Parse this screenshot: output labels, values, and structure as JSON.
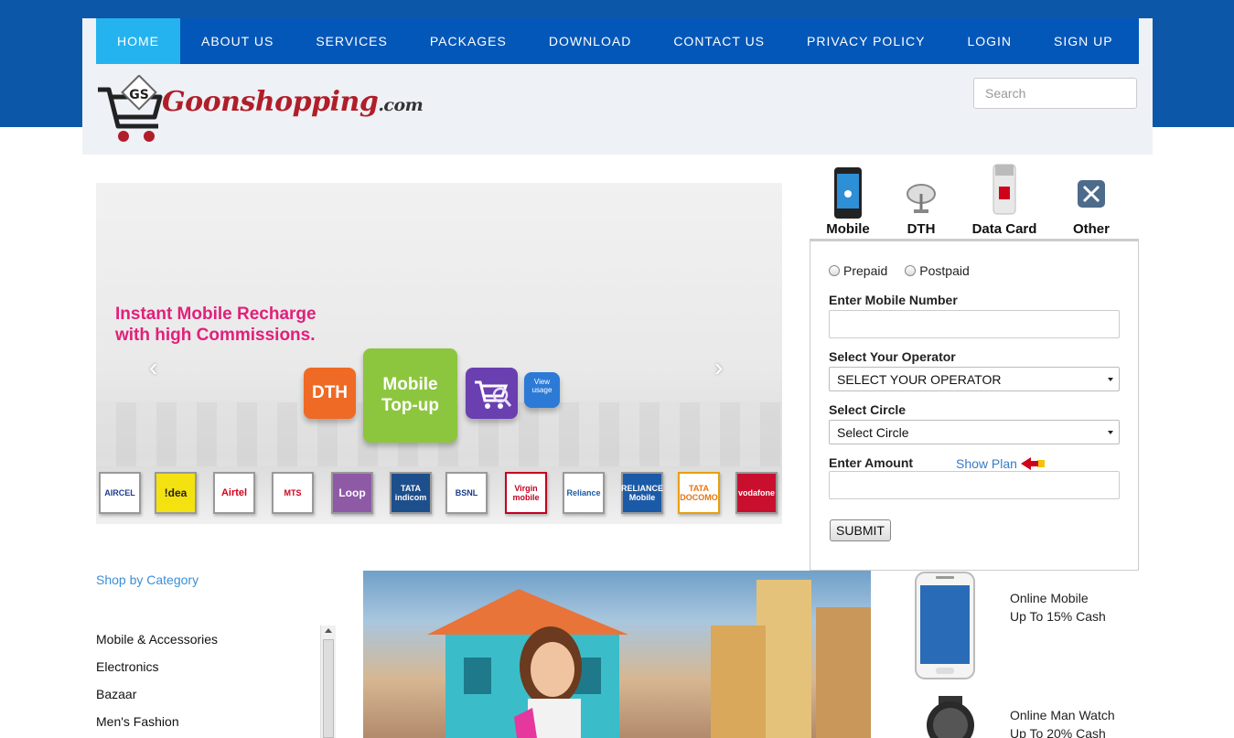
{
  "nav": {
    "items": [
      {
        "label": "HOME",
        "active": true
      },
      {
        "label": "ABOUT US"
      },
      {
        "label": "SERVICES"
      },
      {
        "label": "PACKAGES"
      },
      {
        "label": "DOWNLOAD"
      },
      {
        "label": "CONTACT US"
      },
      {
        "label": "PRIVACY POLICY"
      },
      {
        "label": "LOGIN"
      },
      {
        "label": "SIGN UP"
      }
    ]
  },
  "brand": {
    "initials": "GS",
    "name": "Goonshopping",
    "suffix": ".com"
  },
  "search": {
    "placeholder": "Search"
  },
  "banner": {
    "headline_line1": "Instant Mobile Recharge",
    "headline_line2": "with high Commissions.",
    "tile_dth": "DTH",
    "tile_mobile_line1": "Mobile",
    "tile_mobile_line2": "Top-up",
    "tile_usage": "View usage",
    "operators": [
      "AIRCEL",
      "!dea",
      "Airtel",
      "MTS",
      "Loop",
      "TATA indicom",
      "BSNL",
      "Virgin mobile",
      "Reliance",
      "RELIANCE Mobile",
      "TATA DOCOMO",
      "vodafone"
    ]
  },
  "services": {
    "tabs": [
      {
        "label": "Mobile",
        "icon": "mobile-phone-icon"
      },
      {
        "label": "DTH",
        "icon": "satellite-dish-icon"
      },
      {
        "label": "Data Card",
        "icon": "data-card-icon"
      },
      {
        "label": "Other",
        "icon": "tools-icon"
      }
    ]
  },
  "recharge_form": {
    "prepaid": "Prepaid",
    "postpaid": "Postpaid",
    "mobile_label": "Enter Mobile Number",
    "mobile_value": "",
    "operator_label": "Select Your Operator",
    "operator_value": "SELECT YOUR OPERATOR",
    "circle_label": "Select Circle",
    "circle_value": "Select Circle",
    "amount_label": "Enter Amount",
    "amount_value": "",
    "show_plan": "Show Plan",
    "submit": "SUBMIT"
  },
  "categories": {
    "heading": "Shop by Category",
    "items": [
      "Mobile & Accessories",
      "Electronics",
      "Bazaar",
      "Men's Fashion"
    ]
  },
  "products": [
    {
      "line1": "Online Mobile",
      "line2": "Up To 15% Cash"
    },
    {
      "line1": "Online Man Watch",
      "line2": "Up To 20% Cash"
    }
  ]
}
